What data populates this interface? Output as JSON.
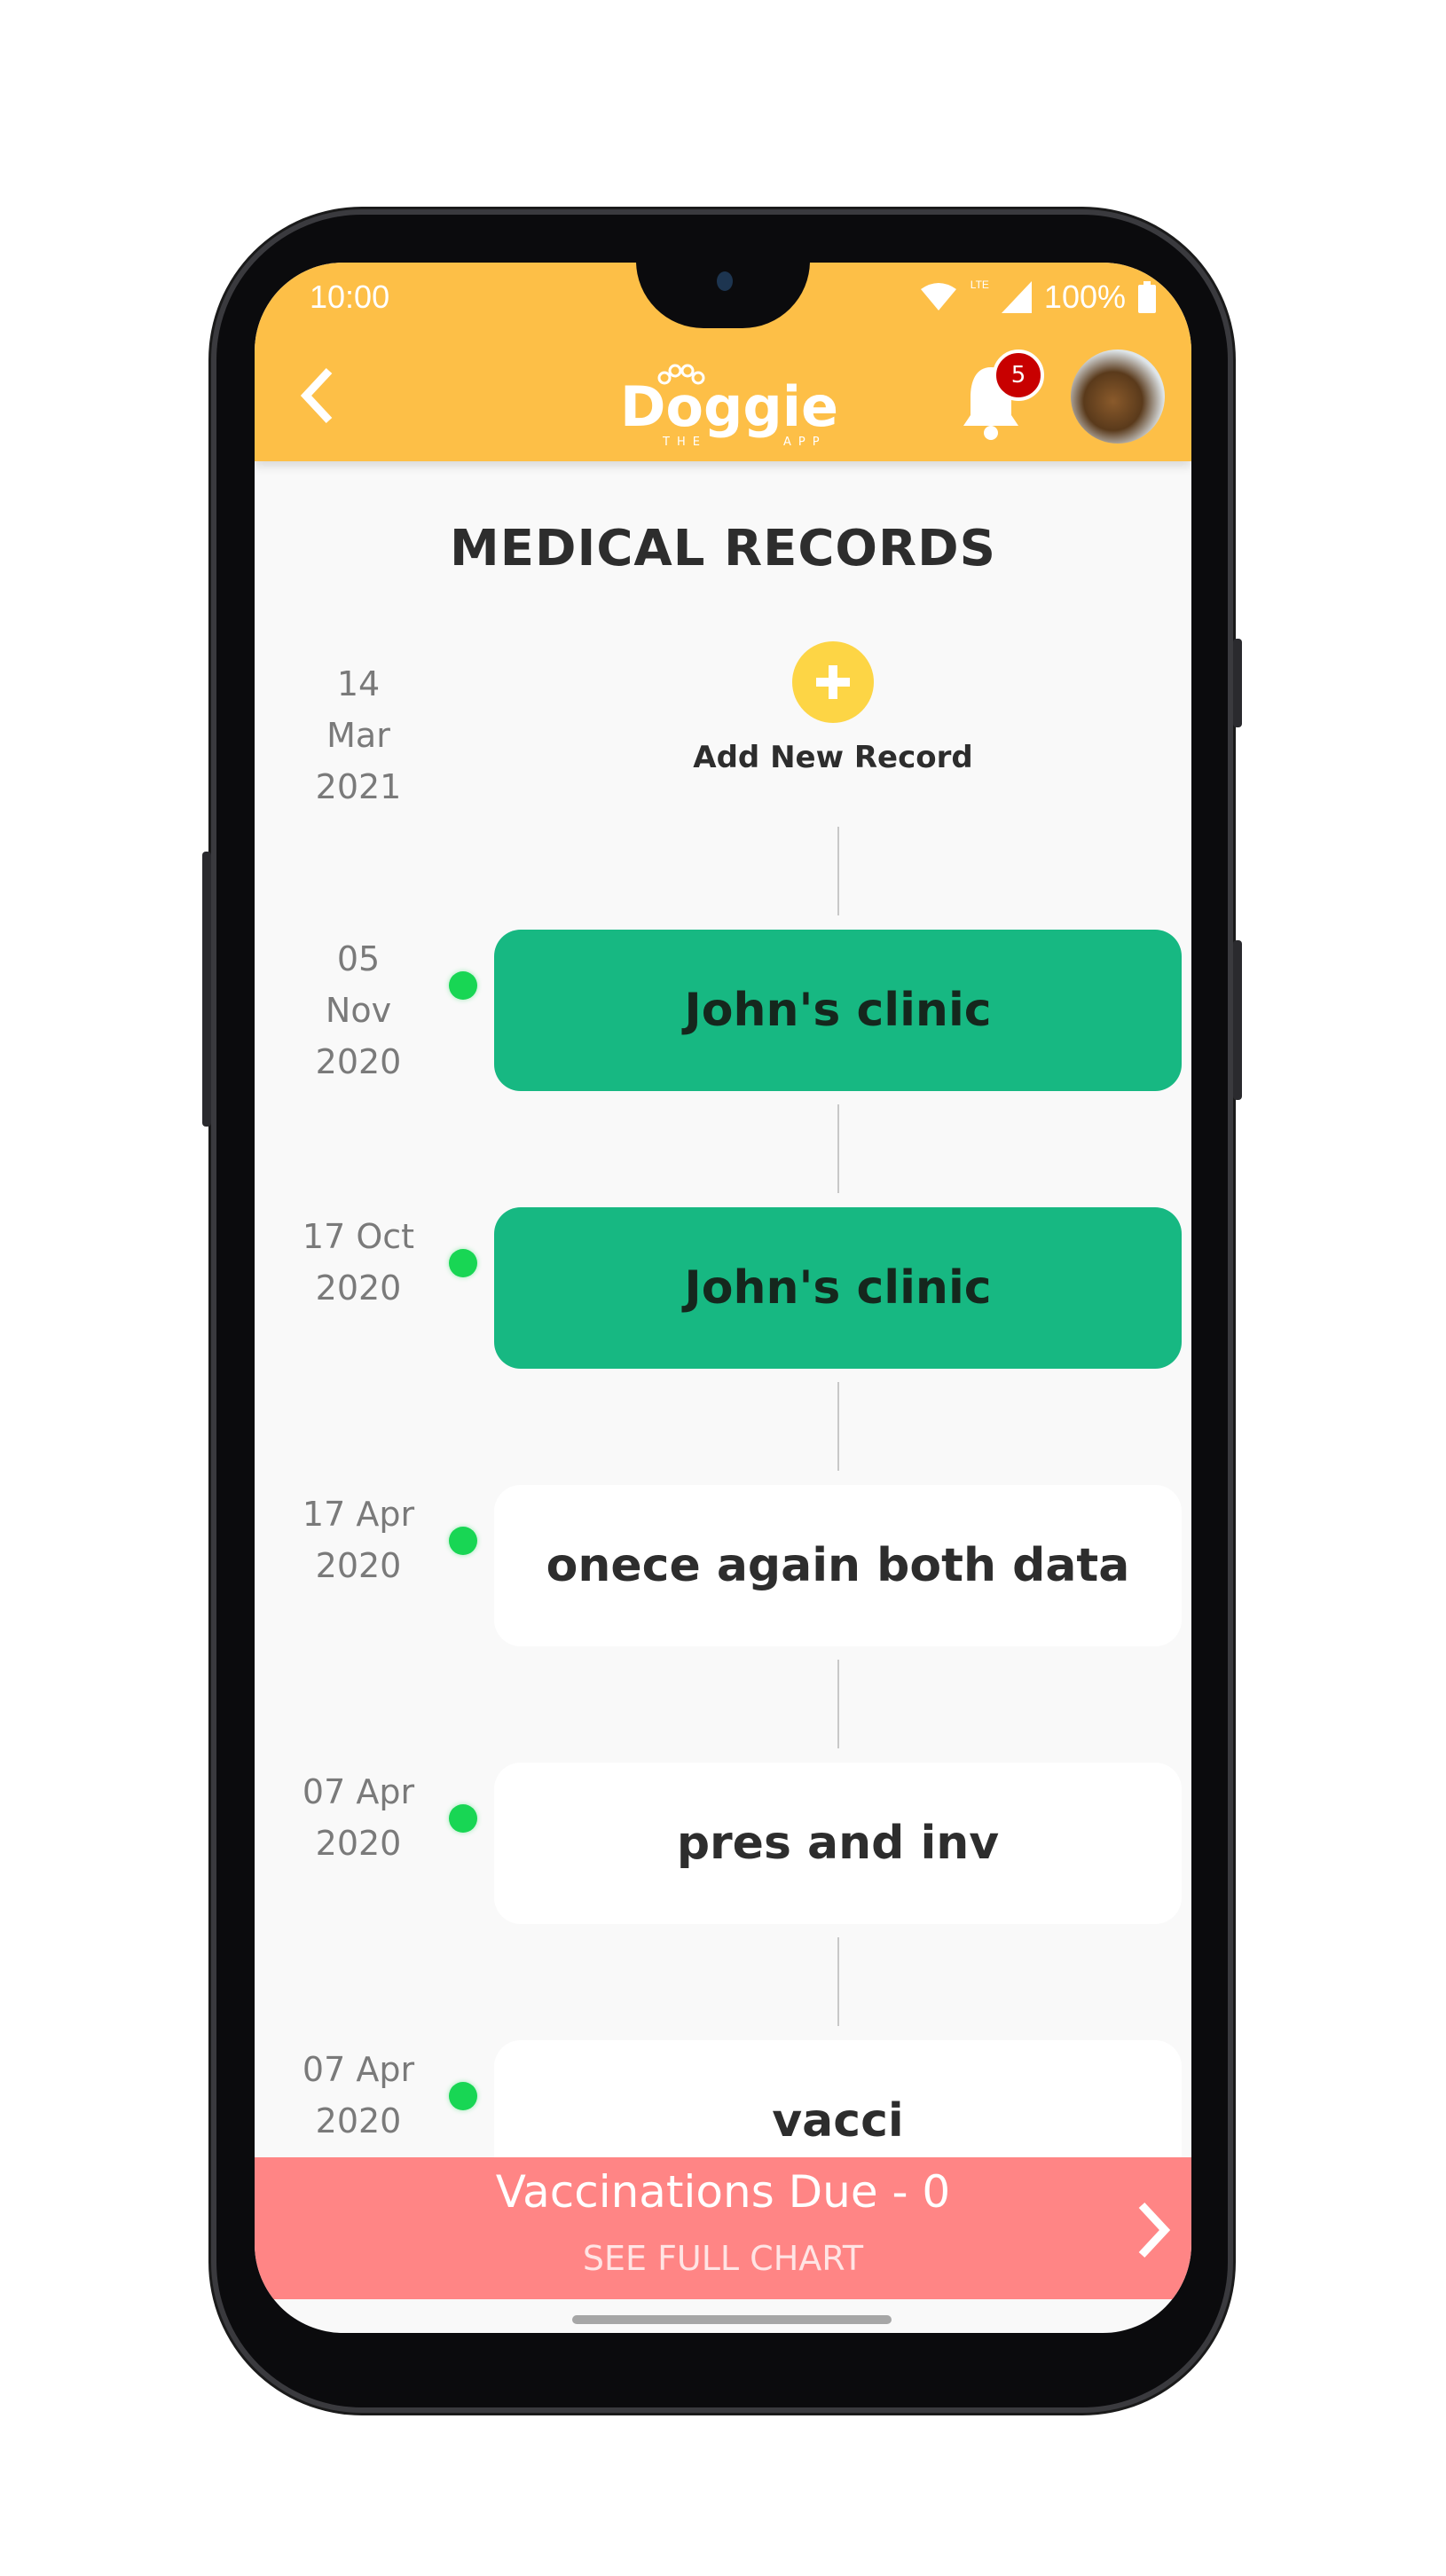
{
  "status_bar": {
    "time": "10:00",
    "network": "LTE",
    "battery": "100%"
  },
  "header": {
    "logo_text": "Doggie",
    "logo_sub": "THE APP",
    "notification_count": "5",
    "accent": "#fdbf47"
  },
  "page_title": "MEDICAL RECORDS",
  "add_record": {
    "date_day": "14 Mar",
    "date_year": "2021",
    "label": "Add New Record"
  },
  "records": [
    {
      "day": "05 Nov",
      "year": "2020",
      "title": "John's clinic",
      "style": "green"
    },
    {
      "day": "17 Oct",
      "year": "2020",
      "title": "John's clinic",
      "style": "green"
    },
    {
      "day": "17 Apr",
      "year": "2020",
      "title": "onece again both data",
      "style": "white"
    },
    {
      "day": "07 Apr",
      "year": "2020",
      "title": "pres and inv",
      "style": "white"
    },
    {
      "day": "07 Apr",
      "year": "2020",
      "title": "vacci",
      "style": "white"
    }
  ],
  "banner": {
    "title": "Vaccinations Due - 0",
    "link": "SEE FULL CHART",
    "color": "#ff8585"
  }
}
